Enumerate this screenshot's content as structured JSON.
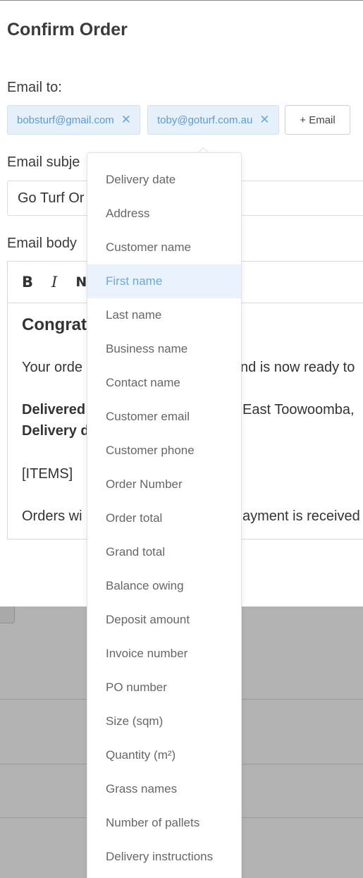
{
  "modal": {
    "title": "Confirm Order",
    "email_to_label": "Email to:",
    "recipients": [
      "bobsturf@gmail.com",
      "toby@goturf.com.au"
    ],
    "chip_remove_glyph": "✕",
    "add_email_label": "+ Email",
    "email_subject_label": "Email subje",
    "subject_value": "Go Turf Or",
    "email_body_label": "Email body"
  },
  "editor": {
    "toolbar": {
      "bold": "B",
      "italic": "I",
      "normal": "N"
    },
    "heading": "Congrat",
    "line1_left": "Your orde",
    "line1_right": "nd is now ready to",
    "delivered_left": "Delivered",
    "delivered_right": "East Toowoomba,",
    "delivery_left": "Delivery d",
    "items": "[ITEMS]",
    "orders_left": "Orders wi",
    "orders_right": "ayment is received"
  },
  "dropdown": {
    "active_index": 3,
    "items": [
      "Delivery date",
      "Address",
      "Customer name",
      "First name",
      "Last name",
      "Business name",
      "Contact name",
      "Customer email",
      "Customer phone",
      "Order Number",
      "Order total",
      "Grand total",
      "Balance owing",
      "Deposit amount",
      "Invoice number",
      "PO number",
      "Size (sqm)",
      "Quantity (m²)",
      "Grass names",
      "Number of pallets",
      "Delivery instructions"
    ]
  },
  "colors": {
    "chip_bg": "#e6f0fb",
    "chip_text": "#5b9bd5",
    "active_item_bg": "#eaf3fd",
    "active_item_text": "#6aa9de",
    "backdrop": "#b3b3b3"
  }
}
